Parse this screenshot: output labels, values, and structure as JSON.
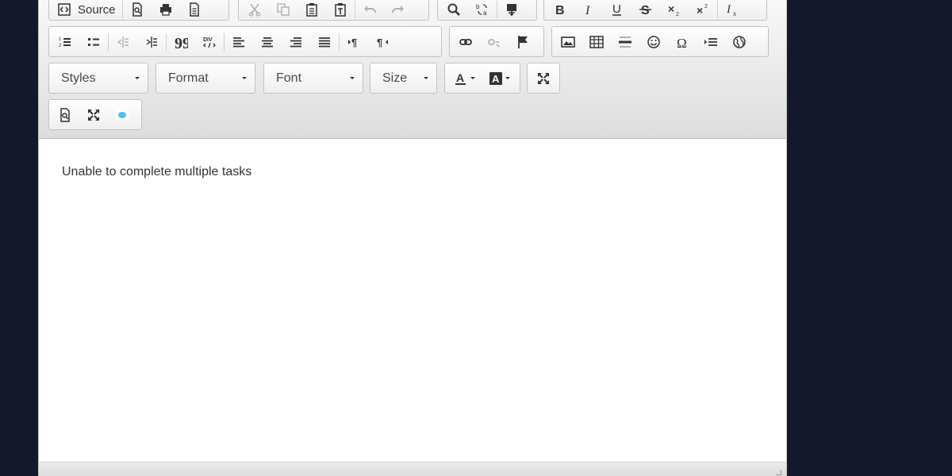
{
  "toolbar": {
    "source_label": "Source",
    "styles_label": "Styles",
    "format_label": "Format",
    "font_label": "Font",
    "size_label": "Size"
  },
  "content": {
    "text": "Unable to complete multiple tasks"
  },
  "colors": {
    "background": "#13182a",
    "toolbar_top": "#f8f8f8",
    "toolbar_bottom": "#dcdedc",
    "text": "#333333",
    "widget_accent": "#4fc0e8"
  },
  "icons": {
    "document_tools": [
      "source-icon",
      "preview-icon",
      "print-icon",
      "templates-icon"
    ],
    "clipboard": [
      "cut-icon",
      "copy-icon",
      "paste-icon",
      "paste-text-icon",
      "undo-icon",
      "redo-icon"
    ],
    "editing": [
      "find-icon",
      "replace-icon",
      "spellcheck-icon"
    ],
    "basic_styles": [
      "bold-icon",
      "italic-icon",
      "underline-icon",
      "strikethrough-icon",
      "subscript-icon",
      "superscript-icon",
      "remove-format-icon"
    ],
    "paragraph": [
      "numbered-list-icon",
      "bulleted-list-icon",
      "decrease-indent-icon",
      "increase-indent-icon",
      "blockquote-icon",
      "div-container-icon",
      "align-left-icon",
      "align-center-icon",
      "align-right-icon",
      "justify-icon",
      "ltr-icon",
      "rtl-icon"
    ],
    "links": [
      "link-icon",
      "unlink-icon",
      "anchor-icon"
    ],
    "insert": [
      "image-icon",
      "table-icon",
      "horizontal-line-icon",
      "smiley-icon",
      "special-char-icon",
      "page-break-icon",
      "iframe-icon"
    ],
    "colors": [
      "text-color-icon",
      "background-color-icon"
    ],
    "tools": [
      "maximize-icon",
      "preview-icon",
      "maximize-icon",
      "widget-icon"
    ]
  }
}
